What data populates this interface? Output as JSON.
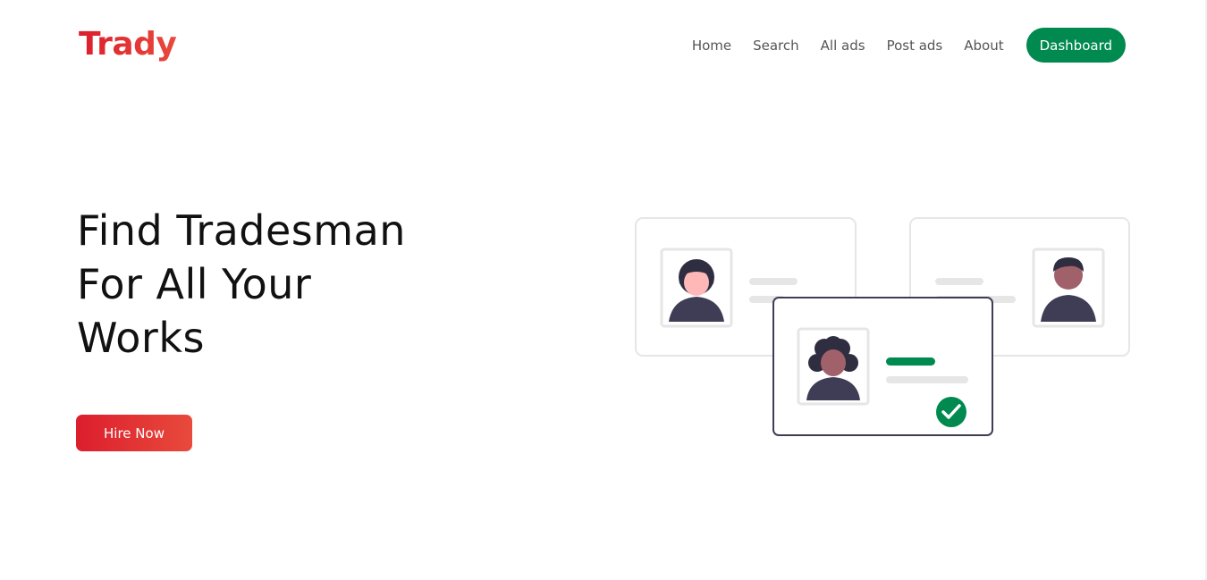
{
  "brand": {
    "name": "Trady",
    "color_start": "#dc1e2d",
    "color_end": "#e84a3c"
  },
  "nav": {
    "items": [
      {
        "label": "Home"
      },
      {
        "label": "Search"
      },
      {
        "label": "All ads"
      },
      {
        "label": "Post ads"
      },
      {
        "label": "About"
      }
    ],
    "dashboard_label": "Dashboard",
    "dashboard_color": "#008a4f"
  },
  "hero": {
    "title_lines": [
      "Find Tradesman",
      "For All Your",
      "Works"
    ],
    "cta_label": "Hire Now"
  },
  "illustration": {
    "name": "profile-cards-illustration",
    "accent_color": "#008a4f",
    "figure_color": "#3f3d56",
    "check_icon": "check-circle-icon"
  }
}
